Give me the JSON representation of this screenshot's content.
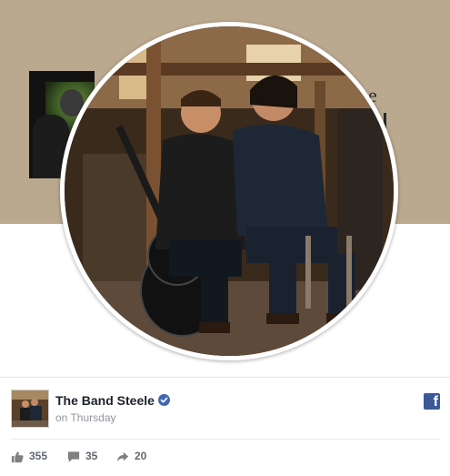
{
  "post": {
    "page_name": "The Band Steele",
    "timestamp": "on Thursday"
  },
  "cover": {
    "partial_text_top": "e",
    "partial_text_bottom": "l"
  },
  "stats": {
    "likes": "355",
    "comments": "35",
    "shares": "20"
  },
  "icons": {
    "verified": "verified-badge-icon",
    "brand": "facebook-logo-icon",
    "like": "thumbs-up-icon",
    "comment": "comment-icon",
    "share": "share-arrow-icon"
  },
  "colors": {
    "cover_background": "#bba98f",
    "verified_blue": "#4267b2",
    "facebook_blue": "#3b5998",
    "meta_text": "#90949c"
  }
}
